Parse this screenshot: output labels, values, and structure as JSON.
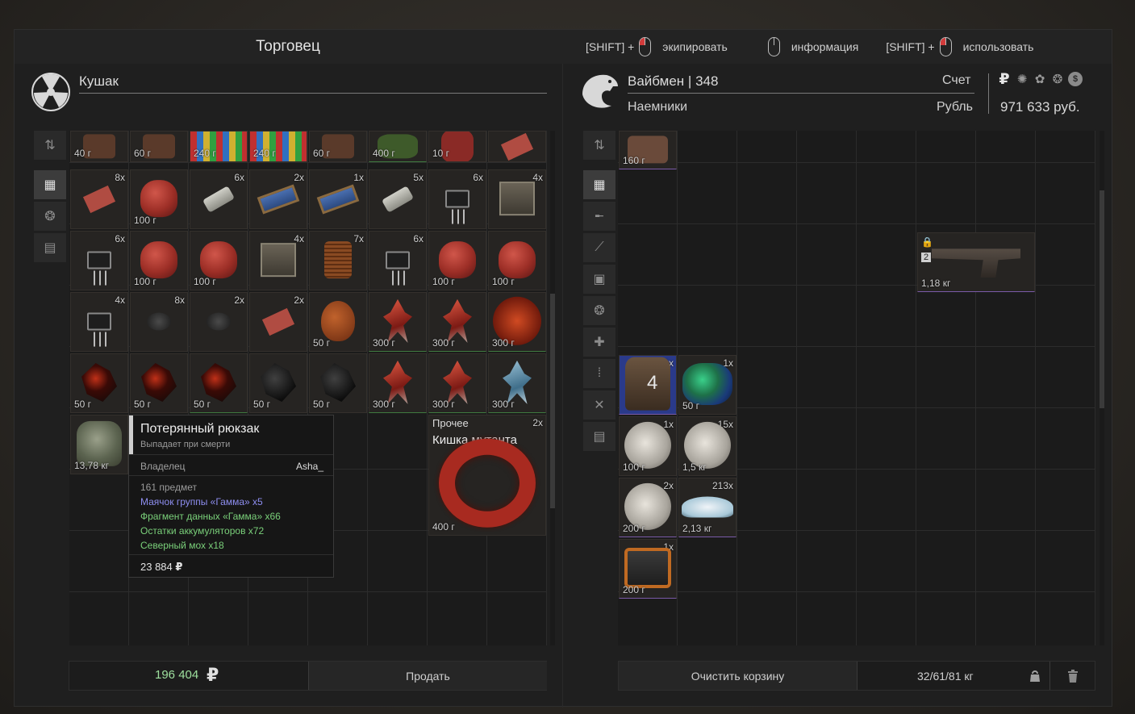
{
  "header": {
    "title": "Торговец",
    "hints": [
      {
        "prefix": "[SHIFT] +",
        "label": "экипировать"
      },
      {
        "prefix": "",
        "label": "информация"
      },
      {
        "prefix": "[SHIFT] +",
        "label": "использовать"
      }
    ]
  },
  "trader": {
    "name": "Кушак"
  },
  "player": {
    "name": "Вайбмен",
    "separator": "|",
    "level": "348",
    "faction": "Наемники",
    "account_label": "Счет",
    "currency_label": "Рубль",
    "money": "971 633 руб.",
    "currency_symbol": "₽"
  },
  "left_items_row0": [
    {
      "price": "40 г"
    },
    {
      "price": "60 г"
    },
    {
      "price": "240 г"
    },
    {
      "price": "240 г"
    },
    {
      "price": "60 г"
    },
    {
      "price": "400 г"
    },
    {
      "price": "10 г"
    },
    {
      "price": ""
    }
  ],
  "left_items": [
    [
      {
        "qty": "8x",
        "price": ""
      },
      {
        "qty": "",
        "price": "100 г"
      },
      {
        "qty": "6x",
        "price": ""
      },
      {
        "qty": "2x",
        "price": ""
      },
      {
        "qty": "1x",
        "price": ""
      },
      {
        "qty": "5x",
        "price": ""
      },
      {
        "qty": "6x",
        "price": ""
      },
      {
        "qty": "4x",
        "price": ""
      }
    ],
    [
      {
        "qty": "6x",
        "price": ""
      },
      {
        "qty": "",
        "price": "100 г"
      },
      {
        "qty": "",
        "price": "100 г"
      },
      {
        "qty": "4x",
        "price": ""
      },
      {
        "qty": "7x",
        "price": ""
      },
      {
        "qty": "6x",
        "price": ""
      },
      {
        "qty": "",
        "price": "100 г"
      },
      {
        "qty": "",
        "price": "100 г"
      }
    ],
    [
      {
        "qty": "4x",
        "price": ""
      },
      {
        "qty": "8x",
        "price": ""
      },
      {
        "qty": "2x",
        "price": ""
      },
      {
        "qty": "2x",
        "price": ""
      },
      {
        "qty": "",
        "price": "50 г"
      },
      {
        "qty": "",
        "price": "300 г"
      },
      {
        "qty": "",
        "price": "300 г"
      },
      {
        "qty": "",
        "price": "300 г"
      }
    ],
    [
      {
        "qty": "",
        "price": "50 г"
      },
      {
        "qty": "",
        "price": "50 г"
      },
      {
        "qty": "",
        "price": "50 г"
      },
      {
        "qty": "",
        "price": "50 г"
      },
      {
        "qty": "",
        "price": "50 г"
      },
      {
        "qty": "",
        "price": "300 г"
      },
      {
        "qty": "",
        "price": "300 г"
      },
      {
        "qty": "",
        "price": "300 г"
      }
    ]
  ],
  "backpack": {
    "weight": "13,78 кг"
  },
  "tooltip": {
    "title": "Потерянный рюкзак",
    "subtitle": "Выпадает при смерти",
    "owner_label": "Владелец",
    "owner": "Asha_",
    "count": "161 предмет",
    "lines": [
      {
        "text": "Маячок группы «Гамма» x5",
        "color": "#8e8ef0"
      },
      {
        "text": "Фрагмент данных «Гамма» x66",
        "color": "#7ad07a"
      },
      {
        "text": "Остатки аккумуляторов x72",
        "color": "#7ad07a"
      },
      {
        "text": "Северный мох x18",
        "color": "#7ad07a"
      }
    ],
    "total": "23 884",
    "total_symbol": "₽"
  },
  "misc_item": {
    "category": "Прочее",
    "qty": "2x",
    "name": "Кишка мутанта",
    "price": "400 г"
  },
  "right_items": {
    "top": {
      "price": "160 г"
    },
    "pistol": {
      "weight": "1,18 кг",
      "level": "2"
    },
    "armor": {
      "qty": "1x",
      "level": "4"
    },
    "moss": {
      "qty": "1x",
      "price": "50 г"
    },
    "snow1": {
      "qty": "1x",
      "price": "100 г"
    },
    "snow2": {
      "qty": "15x",
      "price": "1,5 кг"
    },
    "snow3": {
      "qty": "2x",
      "price": "200 г"
    },
    "salt": {
      "qty": "213x",
      "price": "2,13 кг"
    },
    "tablet": {
      "qty": "1x",
      "price": "200 г"
    }
  },
  "bottom": {
    "sum": "196 404",
    "sum_symbol": "₽",
    "sell": "Продать",
    "clear": "Очистить корзину",
    "weight": "32/61/81 кг"
  },
  "colors": {
    "accent_green": "#9ee09e",
    "tooltip_blue": "#8e8ef0"
  }
}
